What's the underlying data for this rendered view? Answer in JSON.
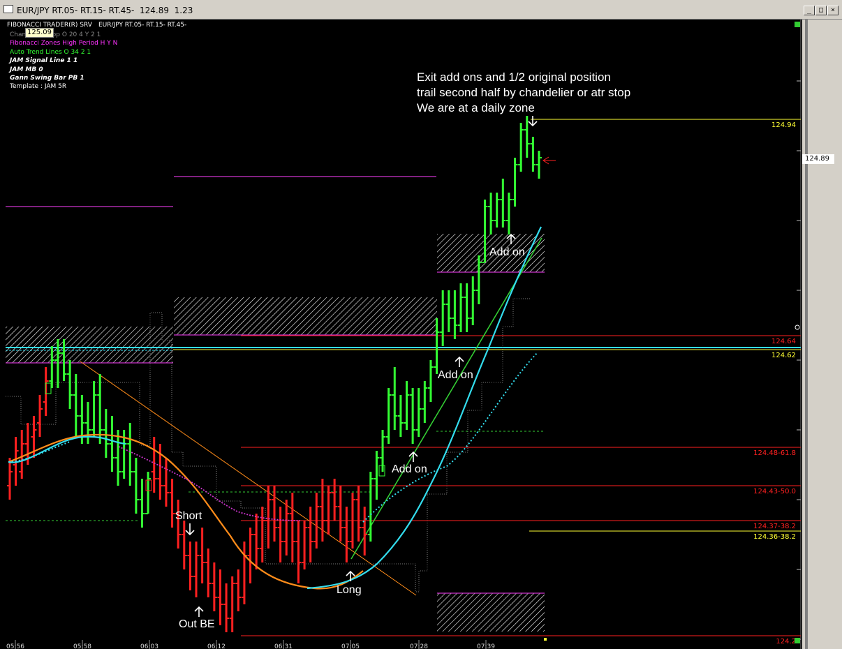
{
  "window": {
    "title": "EUR/JPY RT.05- RT.15- RT.45-  124.89  1.23",
    "minimize_label": "_",
    "maximize_label": "□",
    "close_label": "×"
  },
  "header": {
    "brand": "FIBONACCI TRADER(R) SRV",
    "symbol": "EUR/JPY RT.05- RT.15- RT.45-",
    "last_price": "125.09",
    "indicators": [
      {
        "text": "Chandelier Stop O 20 4 Y 2 1",
        "color": "#888888",
        "bold": false
      },
      {
        "text": "Fibonacci Zones High Period H Y N",
        "color": "#ff33ff",
        "bold": false
      },
      {
        "text": "Auto Trend Lines O 34 2 1",
        "color": "#33ff33",
        "bold": false
      },
      {
        "text": "JAM Signal Line 1 1",
        "color": "#ffffff",
        "bold": true
      },
      {
        "text": "JAM MB 0",
        "color": "#ffffff",
        "bold": true
      },
      {
        "text": "Gann Swing Bar PB 1",
        "color": "#ffffff",
        "bold": true
      },
      {
        "text": "Template : JAM 5R",
        "color": "#ffffff",
        "bold": false
      }
    ]
  },
  "annotations": {
    "note_lines": [
      "Exit add ons and 1/2 original position",
      "trail second half by chandelier or atr stop",
      "We are at a daily zone"
    ],
    "short": "Short",
    "out_be": "Out BE",
    "long": "Long",
    "add_on_1": "Add on",
    "add_on_2": "Add on",
    "add_on_3": "Add on"
  },
  "current_price_label": "124.89",
  "colors": {
    "up_bar": "#33ff33",
    "down_bar": "#ff2020",
    "orange_ma": "#ff8c1a",
    "cyan_ma": "#33ddee",
    "fib_zone_magenta": "#cc33cc",
    "level_red": "#ff2020",
    "level_yellow": "#ffff33"
  },
  "chart_data": {
    "type": "candlestick",
    "ylim": [
      124.2,
      125.05
    ],
    "y_ticks": [
      "124.20",
      "124.30",
      "124.40",
      "124.50",
      "124.60",
      "124.70",
      "124.80",
      "124.90",
      "125.00"
    ],
    "x_ticks": [
      "05:56",
      "05:58",
      "06:03",
      "06:12",
      "06:31",
      "07:05",
      "07:28",
      "07:39"
    ],
    "levels": [
      {
        "label": "124.94",
        "value": 124.945,
        "color": "#ffff33"
      },
      {
        "label": "124.64",
        "value": 124.635,
        "color": "#ff2020"
      },
      {
        "label": "124.62",
        "value": 124.615,
        "color": "#ffff33"
      },
      {
        "label": "124.48-61.8",
        "value": 124.475,
        "color": "#ff2020"
      },
      {
        "label": "124.43-50.0",
        "value": 124.42,
        "color": "#ff2020"
      },
      {
        "label": "124.37-38.2",
        "value": 124.37,
        "color": "#ff2020"
      },
      {
        "label": "124.36-38.2",
        "value": 124.355,
        "color": "#ffff33"
      },
      {
        "label": "124.2",
        "value": 124.205,
        "color": "#ff2020"
      }
    ],
    "bars": [
      {
        "o": 124.42,
        "h": 124.46,
        "l": 124.4,
        "c": 124.44,
        "d": 0
      },
      {
        "o": 124.45,
        "h": 124.49,
        "l": 124.42,
        "c": 124.47,
        "d": 0
      },
      {
        "o": 124.44,
        "h": 124.5,
        "l": 124.43,
        "c": 124.48,
        "d": 0
      },
      {
        "o": 124.48,
        "h": 124.51,
        "l": 124.45,
        "c": 124.46,
        "d": 0
      },
      {
        "o": 124.49,
        "h": 124.52,
        "l": 124.46,
        "c": 124.5,
        "d": 0
      },
      {
        "o": 124.51,
        "h": 124.55,
        "l": 124.49,
        "c": 124.53,
        "d": 0
      },
      {
        "o": 124.54,
        "h": 124.59,
        "l": 124.52,
        "c": 124.57,
        "d": 0
      },
      {
        "o": 124.57,
        "h": 124.62,
        "l": 124.56,
        "c": 124.6,
        "d": 1
      },
      {
        "o": 124.6,
        "h": 124.63,
        "l": 124.56,
        "c": 124.61,
        "d": 1
      },
      {
        "o": 124.61,
        "h": 124.63,
        "l": 124.57,
        "c": 124.58,
        "d": 1
      },
      {
        "o": 124.58,
        "h": 124.6,
        "l": 124.53,
        "c": 124.55,
        "d": 1
      },
      {
        "o": 124.55,
        "h": 124.58,
        "l": 124.49,
        "c": 124.52,
        "d": 1
      },
      {
        "o": 124.52,
        "h": 124.55,
        "l": 124.48,
        "c": 124.51,
        "d": 1
      },
      {
        "o": 124.51,
        "h": 124.54,
        "l": 124.48,
        "c": 124.5,
        "d": 1
      },
      {
        "o": 124.5,
        "h": 124.57,
        "l": 124.49,
        "c": 124.55,
        "d": 1
      },
      {
        "o": 124.55,
        "h": 124.58,
        "l": 124.48,
        "c": 124.5,
        "d": 1
      },
      {
        "o": 124.5,
        "h": 124.53,
        "l": 124.46,
        "c": 124.48,
        "d": 1
      },
      {
        "o": 124.48,
        "h": 124.52,
        "l": 124.44,
        "c": 124.46,
        "d": 1
      },
      {
        "o": 124.46,
        "h": 124.5,
        "l": 124.42,
        "c": 124.44,
        "d": 1
      },
      {
        "o": 124.44,
        "h": 124.5,
        "l": 124.43,
        "c": 124.48,
        "d": 1
      },
      {
        "o": 124.48,
        "h": 124.51,
        "l": 124.42,
        "c": 124.44,
        "d": 1
      },
      {
        "o": 124.44,
        "h": 124.46,
        "l": 124.38,
        "c": 124.4,
        "d": 1
      },
      {
        "o": 124.4,
        "h": 124.43,
        "l": 124.36,
        "c": 124.38,
        "d": 1
      },
      {
        "o": 124.38,
        "h": 124.44,
        "l": 124.38,
        "c": 124.43,
        "d": 1
      },
      {
        "o": 124.44,
        "h": 124.49,
        "l": 124.41,
        "c": 124.43,
        "d": 0
      },
      {
        "o": 124.43,
        "h": 124.48,
        "l": 124.4,
        "c": 124.42,
        "d": 0
      },
      {
        "o": 124.42,
        "h": 124.46,
        "l": 124.39,
        "c": 124.41,
        "d": 0
      },
      {
        "o": 124.41,
        "h": 124.43,
        "l": 124.36,
        "c": 124.38,
        "d": 0
      },
      {
        "o": 124.38,
        "h": 124.4,
        "l": 124.33,
        "c": 124.35,
        "d": 0
      },
      {
        "o": 124.35,
        "h": 124.37,
        "l": 124.3,
        "c": 124.32,
        "d": 0
      },
      {
        "o": 124.32,
        "h": 124.34,
        "l": 124.27,
        "c": 124.29,
        "d": 0
      },
      {
        "o": 124.29,
        "h": 124.34,
        "l": 124.26,
        "c": 124.32,
        "d": 0
      },
      {
        "o": 124.32,
        "h": 124.36,
        "l": 124.28,
        "c": 124.31,
        "d": 0
      },
      {
        "o": 124.31,
        "h": 124.33,
        "l": 124.26,
        "c": 124.28,
        "d": 0
      },
      {
        "o": 124.28,
        "h": 124.31,
        "l": 124.24,
        "c": 124.26,
        "d": 0
      },
      {
        "o": 124.26,
        "h": 124.3,
        "l": 124.22,
        "c": 124.25,
        "d": 0
      },
      {
        "o": 124.25,
        "h": 124.28,
        "l": 124.21,
        "c": 124.23,
        "d": 0
      },
      {
        "o": 124.23,
        "h": 124.29,
        "l": 124.21,
        "c": 124.28,
        "d": 0
      },
      {
        "o": 124.28,
        "h": 124.3,
        "l": 124.24,
        "c": 124.26,
        "d": 0
      },
      {
        "o": 124.26,
        "h": 124.34,
        "l": 124.25,
        "c": 124.32,
        "d": 0
      },
      {
        "o": 124.32,
        "h": 124.36,
        "l": 124.28,
        "c": 124.35,
        "d": 0
      },
      {
        "o": 124.35,
        "h": 124.38,
        "l": 124.3,
        "c": 124.33,
        "d": 0
      },
      {
        "o": 124.33,
        "h": 124.39,
        "l": 124.31,
        "c": 124.37,
        "d": 0
      },
      {
        "o": 124.37,
        "h": 124.42,
        "l": 124.33,
        "c": 124.4,
        "d": 0
      },
      {
        "o": 124.4,
        "h": 124.42,
        "l": 124.34,
        "c": 124.36,
        "d": 0
      },
      {
        "o": 124.36,
        "h": 124.39,
        "l": 124.31,
        "c": 124.34,
        "d": 0
      },
      {
        "o": 124.34,
        "h": 124.4,
        "l": 124.32,
        "c": 124.38,
        "d": 0
      },
      {
        "o": 124.38,
        "h": 124.41,
        "l": 124.31,
        "c": 124.34,
        "d": 0
      },
      {
        "o": 124.34,
        "h": 124.37,
        "l": 124.28,
        "c": 124.31,
        "d": 0
      },
      {
        "o": 124.31,
        "h": 124.37,
        "l": 124.3,
        "c": 124.36,
        "d": 0
      },
      {
        "o": 124.36,
        "h": 124.39,
        "l": 124.31,
        "c": 124.34,
        "d": 0
      },
      {
        "o": 124.34,
        "h": 124.41,
        "l": 124.33,
        "c": 124.39,
        "d": 0
      },
      {
        "o": 124.39,
        "h": 124.43,
        "l": 124.34,
        "c": 124.37,
        "d": 0
      },
      {
        "o": 124.37,
        "h": 124.42,
        "l": 124.35,
        "c": 124.41,
        "d": 0
      },
      {
        "o": 124.41,
        "h": 124.43,
        "l": 124.37,
        "c": 124.39,
        "d": 0
      },
      {
        "o": 124.39,
        "h": 124.42,
        "l": 124.34,
        "c": 124.36,
        "d": 0
      },
      {
        "o": 124.36,
        "h": 124.39,
        "l": 124.31,
        "c": 124.34,
        "d": 0
      },
      {
        "o": 124.34,
        "h": 124.41,
        "l": 124.33,
        "c": 124.4,
        "d": 0
      },
      {
        "o": 124.4,
        "h": 124.42,
        "l": 124.34,
        "c": 124.36,
        "d": 0
      },
      {
        "o": 124.36,
        "h": 124.39,
        "l": 124.32,
        "c": 124.35,
        "d": 0
      },
      {
        "o": 124.35,
        "h": 124.44,
        "l": 124.34,
        "c": 124.43,
        "d": 1
      },
      {
        "o": 124.43,
        "h": 124.47,
        "l": 124.4,
        "c": 124.46,
        "d": 1
      },
      {
        "o": 124.46,
        "h": 124.5,
        "l": 124.44,
        "c": 124.49,
        "d": 1
      },
      {
        "o": 124.49,
        "h": 124.56,
        "l": 124.48,
        "c": 124.55,
        "d": 1
      },
      {
        "o": 124.55,
        "h": 124.59,
        "l": 124.5,
        "c": 124.52,
        "d": 1
      },
      {
        "o": 124.52,
        "h": 124.55,
        "l": 124.49,
        "c": 124.51,
        "d": 1
      },
      {
        "o": 124.51,
        "h": 124.57,
        "l": 124.5,
        "c": 124.55,
        "d": 1
      },
      {
        "o": 124.55,
        "h": 124.56,
        "l": 124.48,
        "c": 124.5,
        "d": 1
      },
      {
        "o": 124.5,
        "h": 124.56,
        "l": 124.49,
        "c": 124.53,
        "d": 1
      },
      {
        "o": 124.53,
        "h": 124.57,
        "l": 124.51,
        "c": 124.56,
        "d": 1
      },
      {
        "o": 124.56,
        "h": 124.6,
        "l": 124.54,
        "c": 124.59,
        "d": 1
      },
      {
        "o": 124.59,
        "h": 124.66,
        "l": 124.58,
        "c": 124.64,
        "d": 1
      },
      {
        "o": 124.64,
        "h": 124.7,
        "l": 124.62,
        "c": 124.68,
        "d": 1
      },
      {
        "o": 124.68,
        "h": 124.7,
        "l": 124.64,
        "c": 124.66,
        "d": 1
      },
      {
        "o": 124.66,
        "h": 124.7,
        "l": 124.63,
        "c": 124.65,
        "d": 1
      },
      {
        "o": 124.65,
        "h": 124.71,
        "l": 124.64,
        "c": 124.69,
        "d": 1
      },
      {
        "o": 124.69,
        "h": 124.71,
        "l": 124.64,
        "c": 124.66,
        "d": 1
      },
      {
        "o": 124.66,
        "h": 124.72,
        "l": 124.65,
        "c": 124.7,
        "d": 1
      },
      {
        "o": 124.7,
        "h": 124.75,
        "l": 124.68,
        "c": 124.74,
        "d": 1
      },
      {
        "o": 124.74,
        "h": 124.83,
        "l": 124.74,
        "c": 124.82,
        "d": 1
      },
      {
        "o": 124.82,
        "h": 124.84,
        "l": 124.78,
        "c": 124.8,
        "d": 1
      },
      {
        "o": 124.8,
        "h": 124.84,
        "l": 124.79,
        "c": 124.83,
        "d": 1
      },
      {
        "o": 124.83,
        "h": 124.86,
        "l": 124.79,
        "c": 124.8,
        "d": 1
      },
      {
        "o": 124.8,
        "h": 124.84,
        "l": 124.78,
        "c": 124.83,
        "d": 1
      },
      {
        "o": 124.83,
        "h": 124.89,
        "l": 124.82,
        "c": 124.88,
        "d": 1
      },
      {
        "o": 124.88,
        "h": 124.94,
        "l": 124.87,
        "c": 124.93,
        "d": 1
      },
      {
        "o": 124.93,
        "h": 124.95,
        "l": 124.89,
        "c": 124.91,
        "d": 1
      },
      {
        "o": 124.91,
        "h": 124.92,
        "l": 124.87,
        "c": 124.88,
        "d": 1
      },
      {
        "o": 124.88,
        "h": 124.9,
        "l": 124.86,
        "c": 124.89,
        "d": 1
      }
    ]
  }
}
